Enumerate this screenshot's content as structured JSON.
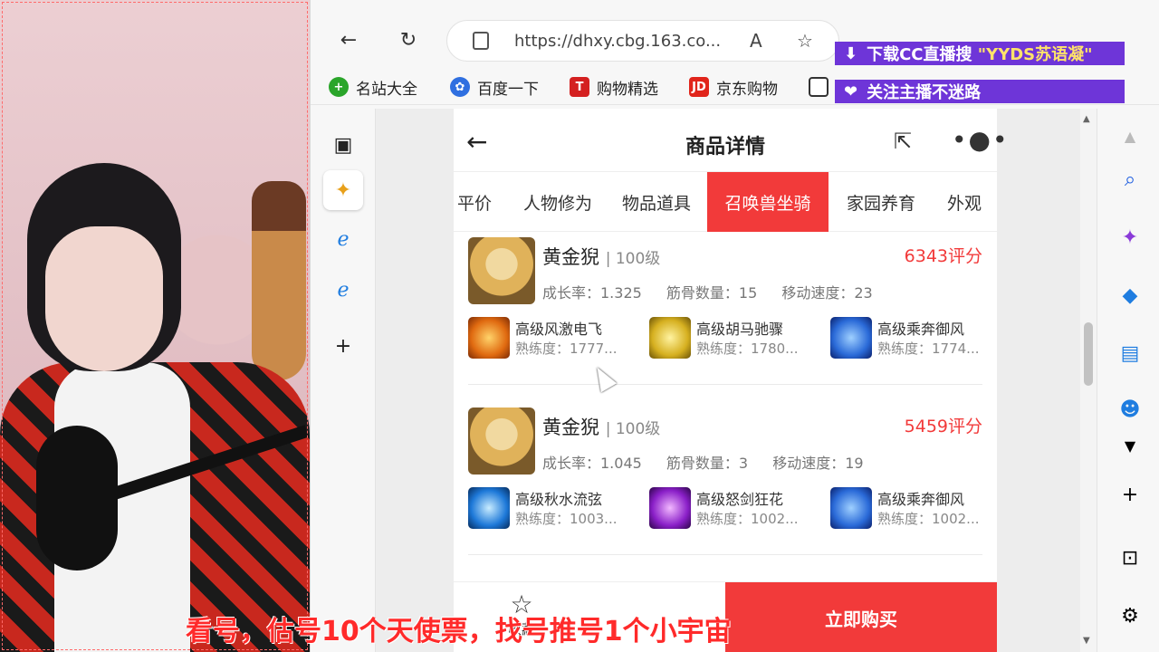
{
  "browser": {
    "url": "https://dhxy.cbg.163.co...",
    "bookmarks": [
      {
        "label": "名站大全",
        "icon": "plus-circle-icon",
        "color": "#2aa52a"
      },
      {
        "label": "百度一下",
        "icon": "baidu-paw-icon",
        "color": "#2f6fe0"
      },
      {
        "label": "购物精选",
        "icon": "T-icon",
        "color": "#d42020"
      },
      {
        "label": "京东购物",
        "icon": "JD-icon",
        "color": "#e1251b"
      }
    ]
  },
  "overlays": {
    "download_text": "下载CC直播搜",
    "download_highlight": "\"YYDS苏语凝\"",
    "follow_text": "关注主播不迷路"
  },
  "page": {
    "title": "商品详情",
    "tabs": [
      "平价",
      "人物修为",
      "物品道具",
      "召唤兽坐骑",
      "家园养育",
      "外观"
    ],
    "active_tab": "召唤兽坐骑",
    "pets": [
      {
        "name": "黄金猊",
        "level": "| 100级",
        "score": "6343评分",
        "growth": "成长率：1.325",
        "bones": "筋骨数量：15",
        "speed": "移动速度：23",
        "skills": [
          {
            "name": "高级风激电飞",
            "prof": "熟练度：1777...",
            "color": "#e06a10"
          },
          {
            "name": "高级胡马驰骤",
            "prof": "熟练度：1780...",
            "color": "#d6b020"
          },
          {
            "name": "高级乘奔御风",
            "prof": "熟练度：1774...",
            "color": "#2a6ad8"
          }
        ]
      },
      {
        "name": "黄金猊",
        "level": "| 100级",
        "score": "5459评分",
        "growth": "成长率：1.045",
        "bones": "筋骨数量：3",
        "speed": "移动速度：19",
        "skills": [
          {
            "name": "高级秋水流弦",
            "prof": "熟练度：1003...",
            "color": "#1d78d8"
          },
          {
            "name": "高级怒剑狂花",
            "prof": "熟练度：1002...",
            "color": "#8a1fc8"
          },
          {
            "name": "高级乘奔御风",
            "prof": "熟练度：1002...",
            "color": "#2a6ad8"
          }
        ]
      }
    ],
    "favorite_label": "收藏",
    "buy_label": "立即购买"
  },
  "subtitle": "看号，估号10个天使票，找号推号1个小宇宙",
  "colors": {
    "accent": "#f23a3a",
    "overlay": "#6e35d8"
  }
}
